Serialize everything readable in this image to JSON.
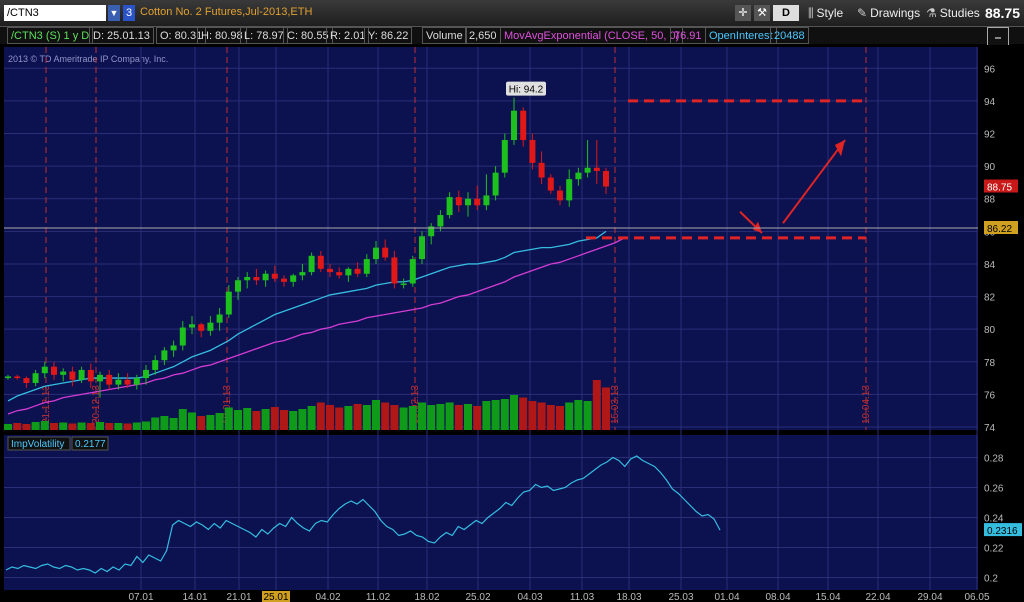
{
  "toolbar": {
    "symbol": "/CTN3",
    "link_number": "3",
    "description": "Cotton No. 2 Futures,Jul-2013,ETH",
    "d_button": "D",
    "style_label": "Style",
    "drawings_label": "Drawings",
    "studies_label": "Studies",
    "last_price": "88.75"
  },
  "infobar": {
    "symbol_period": "/CTN3 (S) 1 y D",
    "date": "D: 25.01.13",
    "open": "O: 80.31",
    "high": "H: 80.98",
    "low": "L: 78.97",
    "close": "C: 80.55",
    "range": "R: 2.01",
    "y": "Y: 86.22",
    "volume_label": "Volume",
    "volume_value": "2,650",
    "ema_label": "MovAvgExponential (CLOSE, 50, 0)",
    "ema_value": "76.91",
    "oi_label": "OpenInterest",
    "oi_value": "20488"
  },
  "copyright": "2013 © TD Ameritrade IP Company, Inc.",
  "colors": {
    "background": "#0c1150",
    "grid": "#2a2f78",
    "up": "#1ec01e",
    "down": "#e01818",
    "ema50": "#d33cd3",
    "ema_fast": "#35bde0",
    "red_line": "#e02424",
    "axis_text": "#bbbbbb"
  },
  "chart_data": [
    {
      "type": "candlestick",
      "title": "",
      "ylim": [
        74,
        97
      ],
      "y_ticks": [
        "96",
        "94",
        "92",
        "90",
        "88",
        "86",
        "84",
        "82",
        "80",
        "78",
        "76",
        "74"
      ],
      "hi_label": "Hi: 94.2",
      "price_badge": "88.75",
      "crosshair_badge": "86.22",
      "date_markers": [
        "21.12.13",
        "20.12.13",
        "18.01.13",
        "15.02.13",
        "15.03.13",
        "19.04.13"
      ],
      "candles": [
        [
          77.0,
          77.2,
          76.9,
          77.1
        ],
        [
          77.1,
          77.2,
          76.9,
          77.0
        ],
        [
          77.0,
          77.1,
          76.4,
          76.7
        ],
        [
          76.7,
          77.5,
          76.5,
          77.3
        ],
        [
          77.3,
          78.0,
          77.0,
          77.7
        ],
        [
          77.7,
          78.0,
          76.9,
          77.2
        ],
        [
          77.2,
          77.6,
          76.8,
          77.4
        ],
        [
          77.4,
          77.7,
          76.5,
          76.9
        ],
        [
          76.9,
          77.7,
          76.7,
          77.5
        ],
        [
          77.5,
          77.9,
          76.4,
          76.8
        ],
        [
          76.8,
          77.4,
          75.8,
          77.2
        ],
        [
          77.2,
          77.5,
          76.3,
          76.6
        ],
        [
          76.6,
          77.3,
          76.3,
          76.9
        ],
        [
          76.9,
          77.3,
          76.4,
          76.6
        ],
        [
          76.6,
          77.2,
          76.3,
          77.0
        ],
        [
          77.0,
          77.8,
          76.6,
          77.5
        ],
        [
          77.5,
          78.4,
          77.2,
          78.1
        ],
        [
          78.1,
          78.9,
          77.8,
          78.7
        ],
        [
          78.7,
          79.3,
          78.3,
          79.0
        ],
        [
          79.0,
          80.5,
          78.7,
          80.1
        ],
        [
          80.1,
          80.8,
          79.7,
          80.3
        ],
        [
          80.3,
          80.4,
          79.5,
          79.9
        ],
        [
          79.9,
          80.8,
          79.6,
          80.4
        ],
        [
          80.4,
          81.3,
          79.9,
          80.9
        ],
        [
          80.9,
          82.7,
          80.7,
          82.3
        ],
        [
          82.3,
          83.2,
          81.8,
          83.0
        ],
        [
          83.0,
          83.5,
          82.5,
          83.2
        ],
        [
          83.2,
          83.7,
          82.7,
          83.0
        ],
        [
          83.0,
          83.6,
          82.6,
          83.4
        ],
        [
          83.4,
          83.9,
          82.9,
          83.1
        ],
        [
          83.1,
          83.3,
          82.6,
          82.9
        ],
        [
          82.9,
          83.4,
          82.6,
          83.3
        ],
        [
          83.3,
          84.0,
          83.0,
          83.5
        ],
        [
          83.5,
          84.7,
          83.3,
          84.5
        ],
        [
          84.5,
          84.8,
          83.5,
          83.7
        ],
        [
          83.7,
          84.0,
          83.2,
          83.5
        ],
        [
          83.5,
          83.8,
          83.1,
          83.3
        ],
        [
          83.3,
          83.8,
          82.9,
          83.7
        ],
        [
          83.7,
          84.1,
          83.2,
          83.4
        ],
        [
          83.4,
          84.6,
          83.2,
          84.3
        ],
        [
          84.3,
          85.4,
          84.0,
          85.0
        ],
        [
          85.0,
          85.5,
          84.2,
          84.4
        ],
        [
          84.4,
          84.8,
          82.5,
          82.8
        ],
        [
          82.8,
          83.1,
          82.5,
          82.8
        ],
        [
          82.8,
          84.5,
          82.6,
          84.3
        ],
        [
          84.3,
          86.0,
          84.0,
          85.7
        ],
        [
          85.7,
          86.5,
          85.2,
          86.3
        ],
        [
          86.3,
          87.3,
          86.0,
          87.0
        ],
        [
          87.0,
          88.4,
          86.8,
          88.1
        ],
        [
          88.1,
          88.5,
          87.2,
          87.6
        ],
        [
          87.6,
          88.4,
          86.9,
          88.0
        ],
        [
          88.0,
          88.8,
          87.3,
          87.6
        ],
        [
          87.6,
          89.5,
          87.3,
          88.2
        ],
        [
          88.2,
          90.0,
          87.9,
          89.6
        ],
        [
          89.6,
          92.0,
          89.3,
          91.6
        ],
        [
          91.6,
          94.2,
          91.3,
          93.4
        ],
        [
          93.4,
          93.6,
          91.2,
          91.6
        ],
        [
          91.6,
          92.0,
          89.8,
          90.2
        ],
        [
          90.2,
          90.9,
          88.9,
          89.3
        ],
        [
          89.3,
          89.5,
          88.3,
          88.5
        ],
        [
          88.5,
          88.8,
          87.6,
          87.9
        ],
        [
          87.9,
          89.8,
          87.5,
          89.2
        ],
        [
          89.2,
          89.9,
          88.8,
          89.6
        ],
        [
          89.6,
          91.6,
          89.3,
          89.9
        ],
        [
          89.9,
          91.6,
          88.9,
          89.7
        ],
        [
          89.7,
          89.9,
          88.3,
          88.75
        ]
      ],
      "series": [
        {
          "values": [
            74.8,
            75.0,
            75.1,
            75.3,
            75.5,
            75.6,
            75.8,
            75.9,
            76.0,
            76.1,
            76.2,
            76.3,
            76.4,
            76.5,
            76.6,
            76.7,
            76.9,
            77.0,
            77.2,
            77.3,
            77.5,
            77.7,
            77.8,
            78.0,
            78.2,
            78.4,
            78.6,
            78.8,
            79.0,
            79.2,
            79.3,
            79.5,
            79.7,
            79.8,
            80.0,
            80.1,
            80.3,
            80.4,
            80.5,
            80.7,
            80.8,
            80.9,
            81.0,
            81.1,
            81.2,
            81.3,
            81.5,
            81.6,
            81.8,
            82.0,
            82.1,
            82.3,
            82.5,
            82.7,
            82.9,
            83.2,
            83.4,
            83.6,
            83.8,
            84.0,
            84.1,
            84.3,
            84.5,
            84.7,
            84.9,
            85.1,
            85.3,
            85.6
          ]
        },
        {
          "values": [
            75.6,
            75.9,
            76.1,
            76.3,
            76.5,
            76.6,
            76.7,
            76.8,
            76.9,
            77.0,
            77.0,
            77.0,
            77.0,
            77.0,
            77.0,
            77.1,
            77.3,
            77.5,
            77.7,
            78.0,
            78.3,
            78.5,
            78.7,
            79.0,
            79.3,
            79.7,
            80.0,
            80.3,
            80.6,
            80.9,
            81.1,
            81.3,
            81.5,
            81.7,
            81.9,
            82.1,
            82.2,
            82.3,
            82.4,
            82.5,
            82.7,
            82.8,
            82.9,
            82.9,
            83.0,
            83.2,
            83.4,
            83.6,
            83.8,
            83.9,
            84.0,
            84.0,
            84.1,
            84.2,
            84.4,
            84.7,
            84.8,
            84.9,
            85.0,
            85.0,
            85.1,
            85.2,
            85.4,
            85.5,
            85.6,
            86.0
          ]
        }
      ],
      "volume": [
        12,
        14,
        12,
        16,
        18,
        14,
        15,
        13,
        15,
        14,
        16,
        14,
        14,
        13,
        15,
        17,
        25,
        28,
        24,
        42,
        35,
        28,
        30,
        34,
        45,
        40,
        44,
        38,
        42,
        46,
        40,
        38,
        42,
        48,
        55,
        50,
        45,
        48,
        52,
        50,
        60,
        55,
        50,
        45,
        48,
        55,
        50,
        52,
        55,
        50,
        52,
        48,
        58,
        60,
        62,
        70,
        65,
        58,
        55,
        50,
        48,
        55,
        60,
        58,
        100,
        85
      ]
    },
    {
      "type": "line",
      "title": "",
      "label": "ImpVolatility",
      "label_value": "0.2177",
      "ylim": [
        0.195,
        0.285
      ],
      "y_ticks": [
        "0.28",
        "0.26",
        "0.24",
        "0.22",
        "0.2"
      ],
      "current_badge": "0.2316",
      "values": [
        0.205,
        0.207,
        0.206,
        0.208,
        0.207,
        0.206,
        0.208,
        0.209,
        0.207,
        0.206,
        0.208,
        0.207,
        0.205,
        0.206,
        0.205,
        0.203,
        0.206,
        0.204,
        0.207,
        0.205,
        0.209,
        0.208,
        0.214,
        0.21,
        0.215,
        0.213,
        0.211,
        0.218,
        0.235,
        0.238,
        0.236,
        0.234,
        0.237,
        0.235,
        0.232,
        0.236,
        0.233,
        0.238,
        0.236,
        0.234,
        0.232,
        0.23,
        0.227,
        0.232,
        0.229,
        0.233,
        0.236,
        0.234,
        0.24,
        0.236,
        0.233,
        0.231,
        0.236,
        0.238,
        0.237,
        0.242,
        0.246,
        0.249,
        0.251,
        0.249,
        0.252,
        0.248,
        0.244,
        0.238,
        0.234,
        0.232,
        0.228,
        0.229,
        0.231,
        0.228,
        0.227,
        0.224,
        0.223,
        0.227,
        0.23,
        0.228,
        0.234,
        0.232,
        0.235,
        0.238,
        0.236,
        0.24,
        0.243,
        0.246,
        0.25,
        0.248,
        0.253,
        0.257,
        0.258,
        0.262,
        0.26,
        0.261,
        0.258,
        0.259,
        0.26,
        0.263,
        0.265,
        0.266,
        0.269,
        0.272,
        0.275,
        0.277,
        0.28,
        0.278,
        0.274,
        0.279,
        0.281,
        0.278,
        0.276,
        0.274,
        0.27,
        0.265,
        0.259,
        0.256,
        0.252,
        0.248,
        0.244,
        0.241,
        0.242,
        0.239,
        0.2316
      ]
    }
  ],
  "x_axis_labels": [
    "07.01",
    "14.01",
    "21.01",
    "25.01",
    "04.02",
    "11.02",
    "18.02",
    "25.02",
    "04.03",
    "11.03",
    "18.03",
    "25.03",
    "01.04",
    "08.04",
    "15.04",
    "22.04",
    "29.04",
    "06.05"
  ]
}
